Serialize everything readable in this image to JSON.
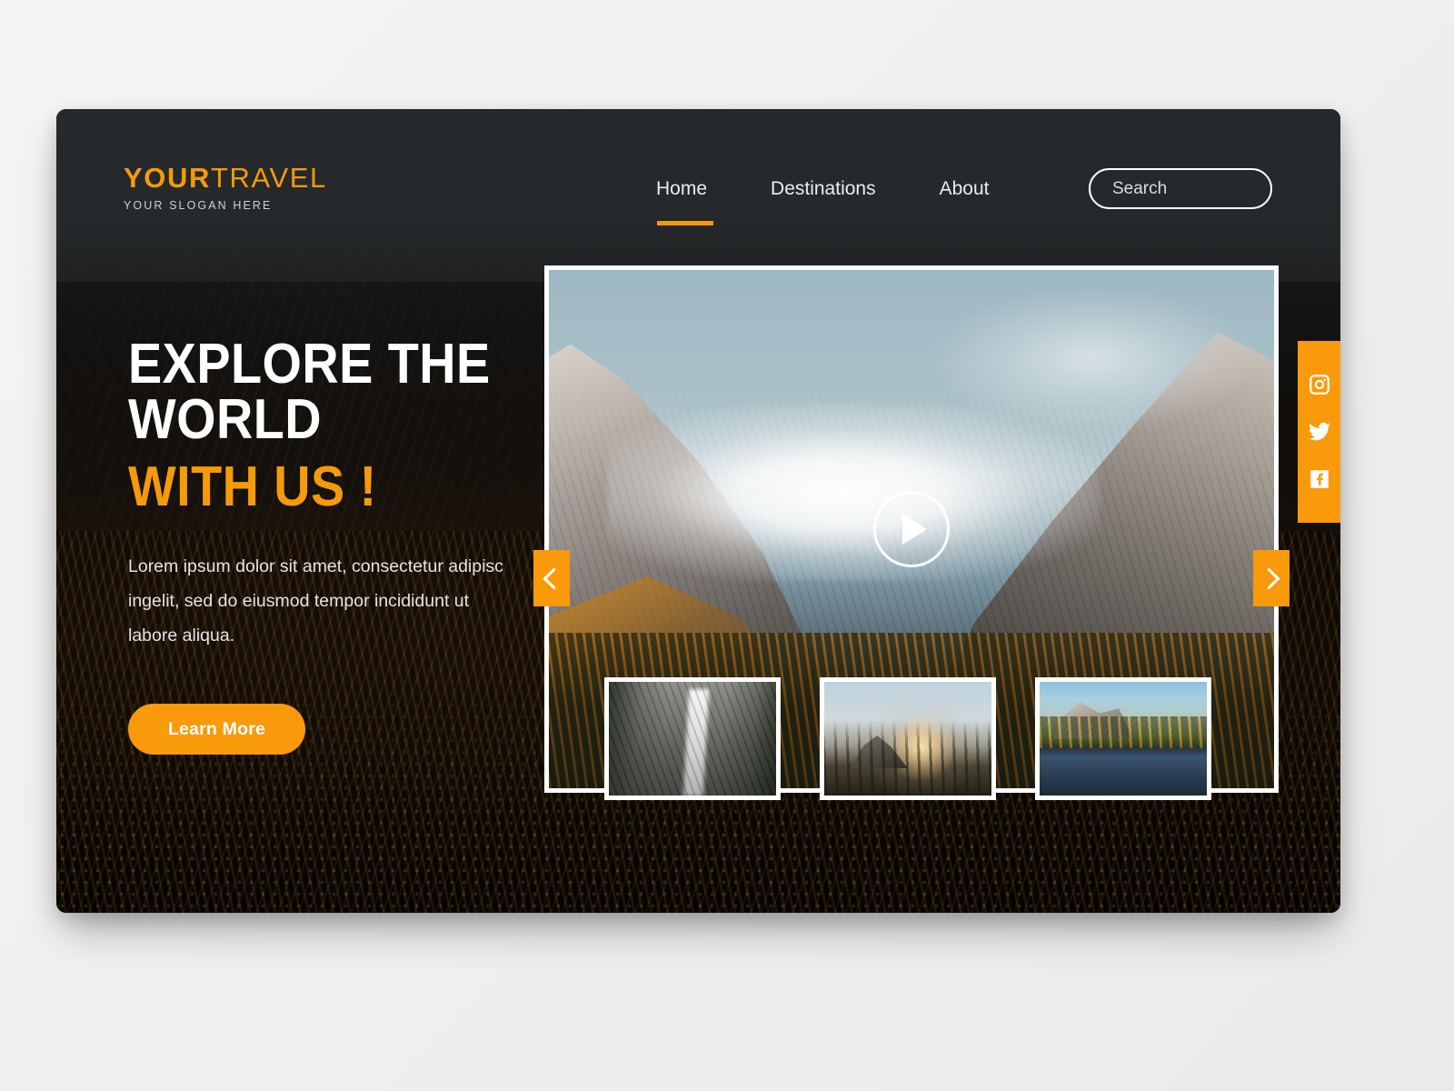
{
  "brand": {
    "name_bold": "YOUR",
    "name_light": "TRAVEL",
    "slogan": "YOUR SLOGAN HERE",
    "accent_color": "#f99a0b",
    "dark_color": "#26292b"
  },
  "nav": {
    "items": [
      {
        "label": "Home",
        "active": true
      },
      {
        "label": "Destinations",
        "active": false
      },
      {
        "label": "About",
        "active": false
      }
    ]
  },
  "search": {
    "value": "",
    "placeholder": "Search",
    "icon": "search-icon"
  },
  "hero": {
    "headline_line1": "EXPLORE THE WORLD",
    "headline_line2": "WITH US !",
    "paragraph": "Lorem ipsum dolor sit amet, consectetur adipisc ingelit, sed do eiusmod tempor incididunt ut labore aliqua.",
    "cta_label": "Learn More"
  },
  "slider": {
    "play_icon": "play-icon",
    "prev_icon": "chevron-left-icon",
    "next_icon": "chevron-right-icon",
    "main_image_alt": "Alpine mountain peaks with low clouds and autumn forest",
    "thumbnails": [
      {
        "alt": "Waterfall in a granite canyon surrounded by pine trees"
      },
      {
        "alt": "Sunrise over a mountain dome with pine silhouettes"
      },
      {
        "alt": "Valley lake reflection with golden trees and distant waterfall"
      }
    ]
  },
  "social": {
    "items": [
      {
        "name": "instagram-icon",
        "label": "Instagram"
      },
      {
        "name": "twitter-icon",
        "label": "Twitter"
      },
      {
        "name": "facebook-icon",
        "label": "Facebook"
      }
    ]
  }
}
